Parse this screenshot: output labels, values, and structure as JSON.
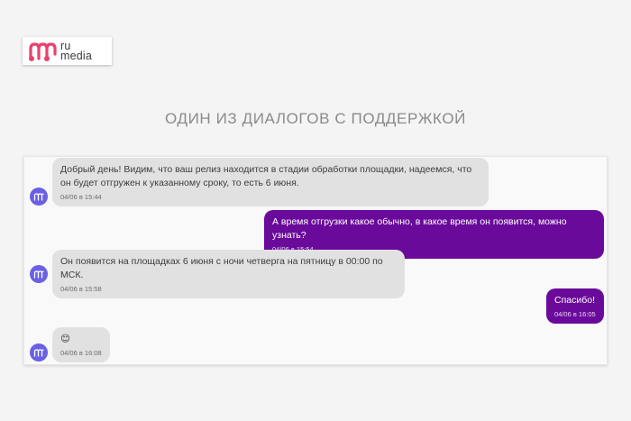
{
  "logo": {
    "line1": "ru",
    "line2": "media",
    "brand_color": "#e8426c"
  },
  "page": {
    "title": "ОДИН ИЗ ДИАЛОГОВ С ПОДДЕРЖКОЙ"
  },
  "chat": {
    "colors": {
      "incoming_bubble": "#e1e1e1",
      "outgoing_bubble": "#6a0a9a",
      "avatar": "#6a60e6"
    },
    "messages": [
      {
        "sender": "support",
        "text": "Добрый день! Видим, что ваш релиз находится в стадии обработки площадки, надеемся, что он будет отгружен к указанному сроку, то есть 6 июня.",
        "time": "04/06 в 15:44"
      },
      {
        "sender": "user",
        "text": "А время отгрузки какое обычно, в какое время он появится, можно узнать?",
        "time": "04/06 в 15:54"
      },
      {
        "sender": "support",
        "text": "Он появится на площадках 6 июня с ночи четверга на пятницу в 00:00 по МСК.",
        "time": "04/06 в 15:58"
      },
      {
        "sender": "user",
        "text": "Спасибо!",
        "time": "04/06 в 16:05"
      },
      {
        "sender": "support",
        "text": "😊",
        "time": "04/06 в 16:08"
      }
    ]
  }
}
